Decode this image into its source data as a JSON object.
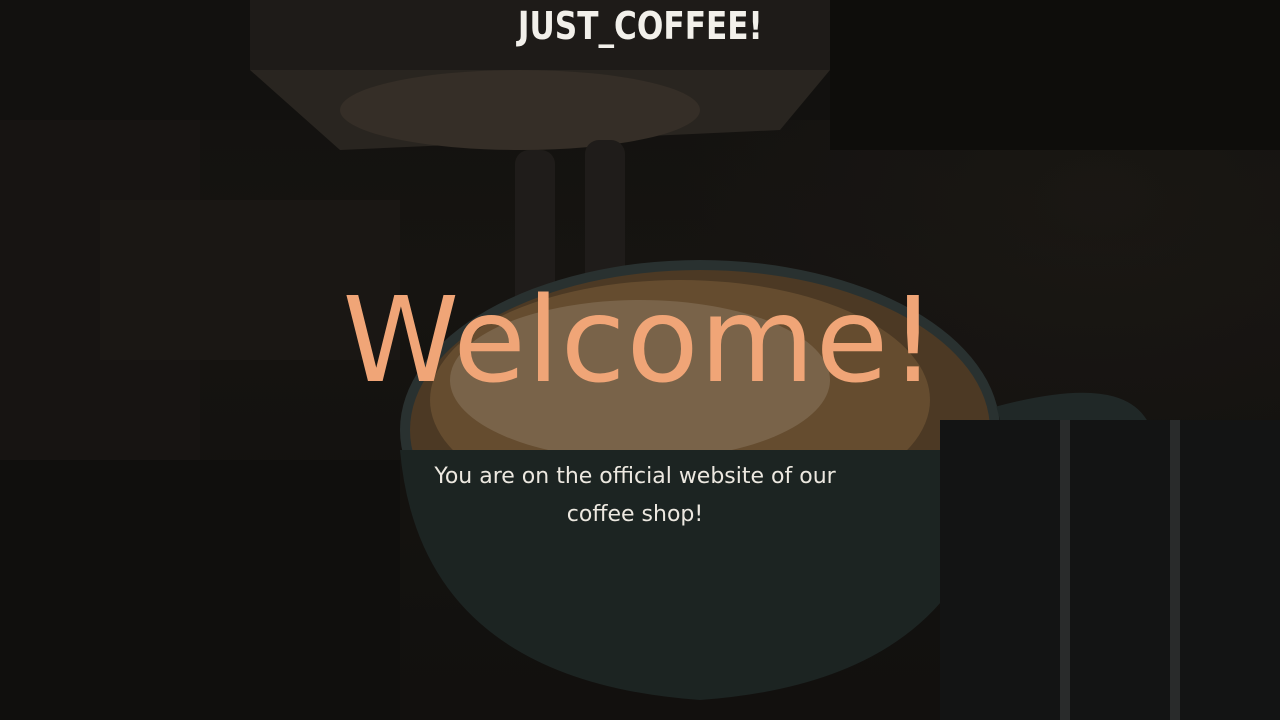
{
  "header": {
    "brand": "JUST_COFFEE!"
  },
  "hero": {
    "headline": "Welcome!",
    "subtitle": "You are on the official website of our coffee shop!",
    "background_image": "espresso-machine-pouring-coffee-into-cup-photo"
  },
  "colors": {
    "accent": "#f0a577",
    "text_light": "#ece8e0",
    "background_dark": "#1b1916"
  }
}
